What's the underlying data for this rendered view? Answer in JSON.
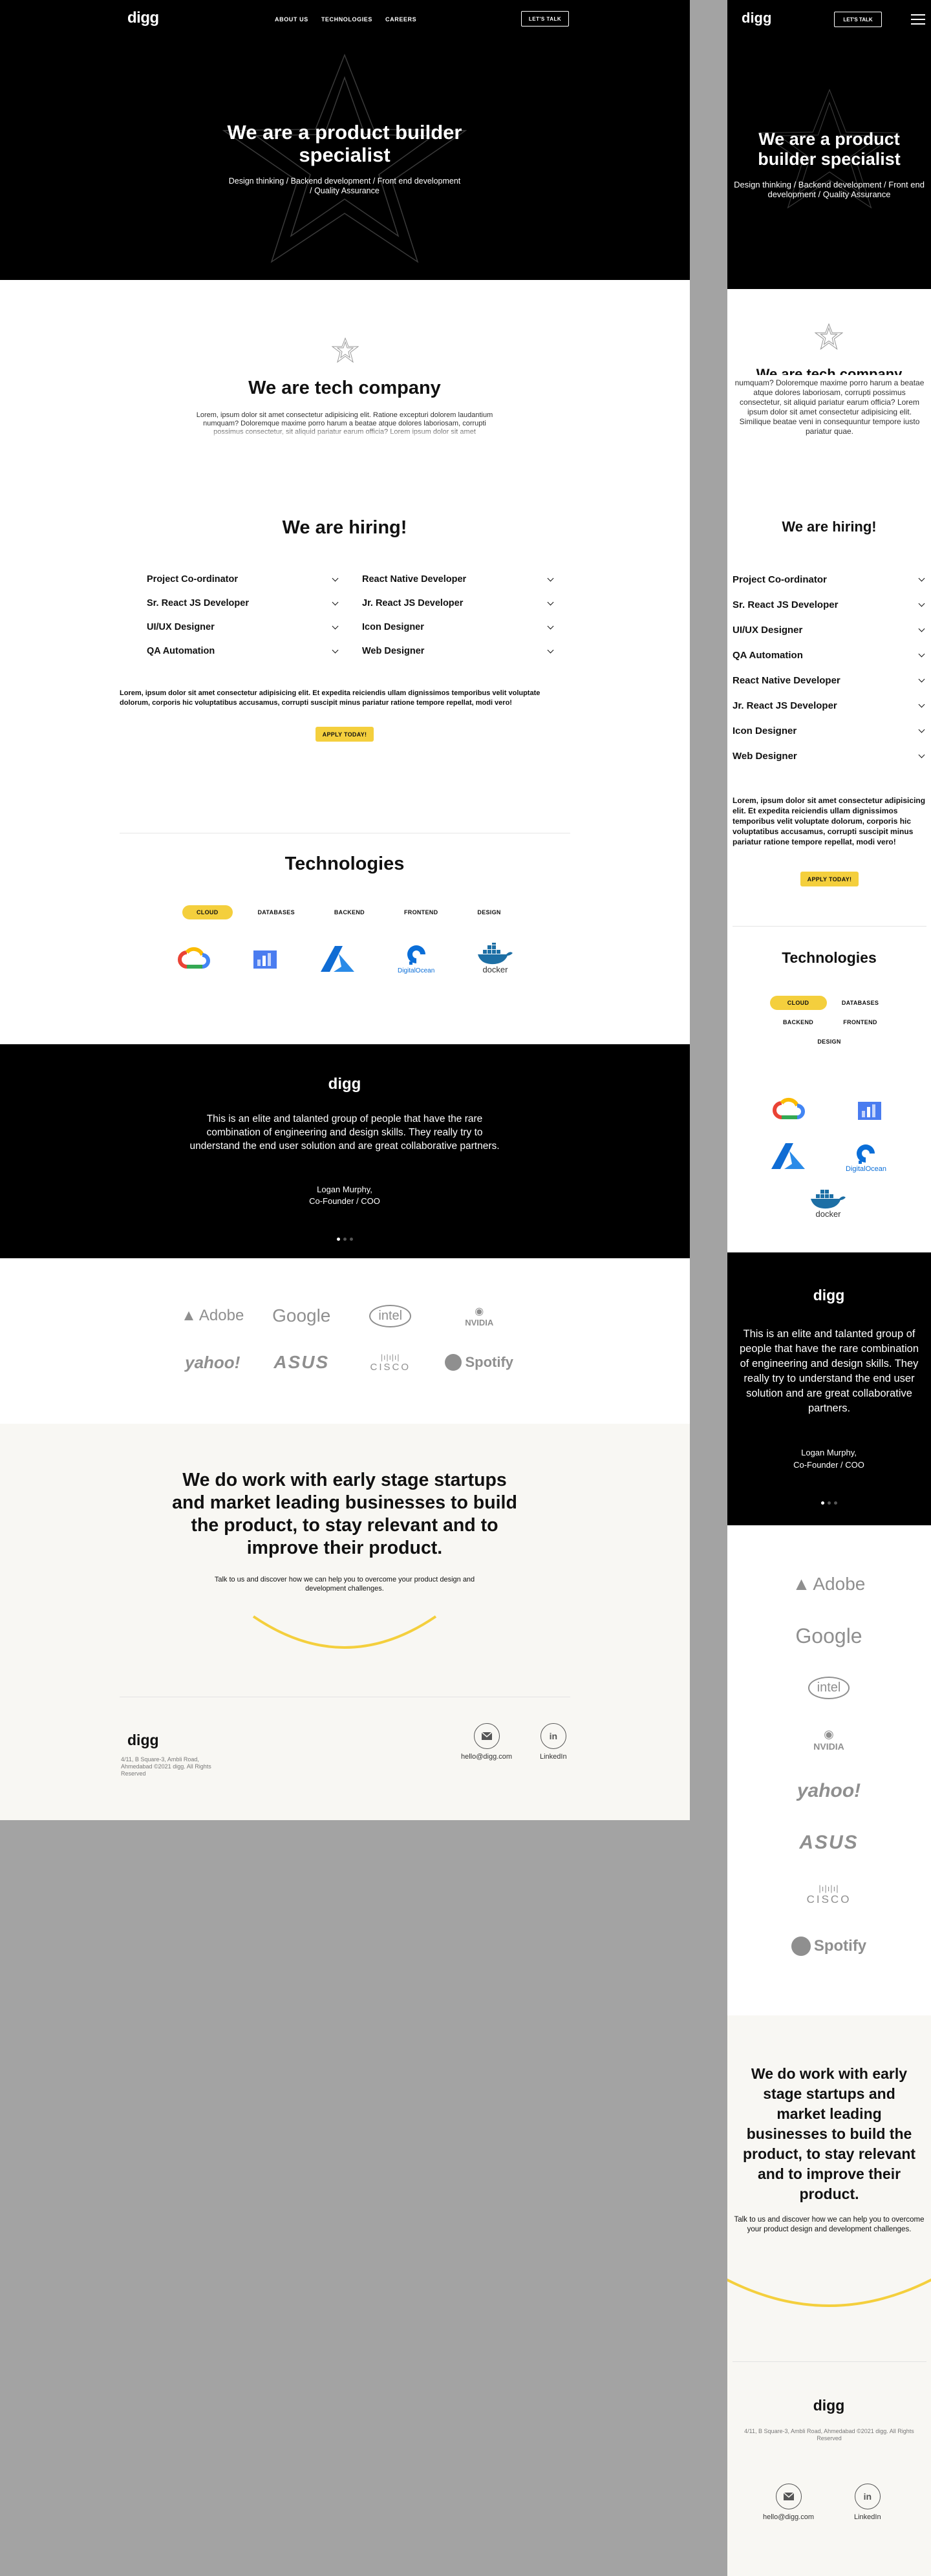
{
  "brand": {
    "logo": "digg"
  },
  "nav": {
    "items": [
      "ABOUT US",
      "TECHNOLOGIES",
      "CAREERS"
    ],
    "cta": "LET'S TALK"
  },
  "hero": {
    "title": "We are a product builder specialist",
    "subtitle": "Design thinking / Backend development / Front end development / Quality Assurance"
  },
  "about": {
    "title": "We are tech company",
    "text": "Lorem, ipsum dolor sit amet consectetur adipisicing elit. Ratione excepturi dolorem laudantium numquam? Doloremque maxime porro harum a beatae atque dolores laboriosam, corrupti possimus consectetur, sit aliquid pariatur earum officia? Lorem ipsum dolor sit amet consectetur adipisicing elit. Similique beatae veni in consequuntur tempore iusto pariatur quae.",
    "mobile_text": "numquam? Doloremque maxime porro harum a beatae atque dolores laboriosam, corrupti possimus consectetur, sit aliquid pariatur earum officia? Lorem ipsum dolor sit amet consectetur adipisicing elit. Similique beatae veni in consequuntur tempore iusto pariatur quae."
  },
  "hiring": {
    "title": "We are hiring!",
    "jobs_left": [
      "Project Co-ordinator",
      "Sr. React JS Developer",
      "UI/UX Designer",
      "QA Automation"
    ],
    "jobs_right": [
      "React Native Developer",
      "Jr. React JS Developer",
      "Icon Designer",
      "Web Designer"
    ],
    "text": "Lorem, ipsum dolor sit amet consectetur adipisicing elit. Et expedita reiciendis ullam dignissimos temporibus velit voluptate dolorum, corporis hic voluptatibus accusamus, corrupti suscipit minus pariatur ratione tempore repellat, modi vero!",
    "apply": "APPLY TODAY!"
  },
  "technologies": {
    "title": "Technologies",
    "tabs": [
      "CLOUD",
      "DATABASES",
      "BACKEND",
      "FRONTEND",
      "DESIGN"
    ],
    "active_tab": "CLOUD",
    "logos": [
      "google-cloud-icon",
      "google-analytics-icon",
      "azure-icon",
      "digitalocean-icon",
      "docker-icon"
    ],
    "logo_labels": {
      "digitalocean": "DigitalOcean",
      "docker": "docker"
    }
  },
  "testimonial": {
    "logo": "digg",
    "quote": "This is an elite and talanted group of people that have the rare combination of engineering and design skills. They really try to understand the end user solution and are great collaborative partners.",
    "name": "Logan Murphy,",
    "role": "Co-Founder / COO",
    "slides": 3,
    "active": 0
  },
  "brands": [
    "Adobe",
    "Google",
    "intel",
    "NVIDIA",
    "yahoo!",
    "ASUS",
    "CISCO",
    "Spotify"
  ],
  "cta": {
    "title": "We do work with early stage startups and market leading businesses to build the product, to stay relevant and to improve their product.",
    "subtitle": "Talk to us and discover how we can help you to overcome your product design and development challenges."
  },
  "footer": {
    "logo": "digg",
    "address": "4/11, B Square-3, Ambli Road, Ahmedabad ©2021 digg. All Rights Reserved",
    "email": "hello@digg.com",
    "linkedin": "LinkedIn"
  },
  "colors": {
    "accent": "#f4cf3d",
    "dark": "#000000",
    "cream": "#f8f7f3",
    "brand_gray": "#8f8f8f"
  }
}
